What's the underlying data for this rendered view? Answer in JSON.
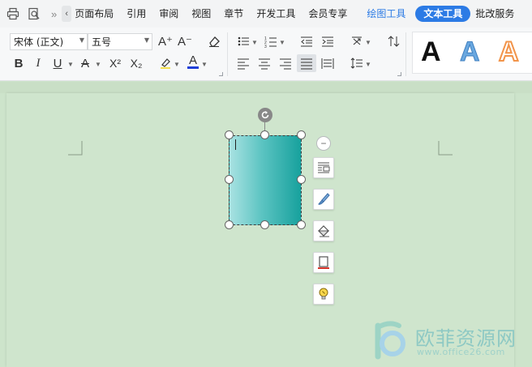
{
  "menubar": {
    "tabs": [
      {
        "label": "页面布局"
      },
      {
        "label": "引用"
      },
      {
        "label": "审阅"
      },
      {
        "label": "视图"
      },
      {
        "label": "章节"
      },
      {
        "label": "开发工具"
      },
      {
        "label": "会员专享"
      },
      {
        "label": "绘图工具"
      },
      {
        "label": "文本工具"
      },
      {
        "label": "批改服务"
      }
    ],
    "more_glyph": "»",
    "back_glyph": "‹"
  },
  "ribbon": {
    "font_name": "宋体 (正文)",
    "font_size": "五号",
    "grow_font": "A⁺",
    "shrink_font": "A⁻",
    "bold": "B",
    "italic": "I",
    "underline": "U",
    "char_color": "A",
    "superscript": "X²",
    "subscript": "X₂",
    "font_color": "A",
    "font_color_value": "#1e3ed8",
    "text_styles": [
      {
        "glyph": "A",
        "color": "#111111"
      },
      {
        "glyph": "A",
        "color": "#4a90d9"
      },
      {
        "glyph": "A",
        "color": "#f39a4a"
      }
    ]
  },
  "shape": {
    "gradient_colors": [
      "#a9e2e2",
      "#5cc4c2",
      "#17a19d"
    ]
  },
  "float_toolbar": {
    "collapse_glyph": "−",
    "buttons": [
      "text-wrap-icon",
      "shape-fill-icon",
      "shape-effect-icon",
      "shape-outline-icon",
      "lightbulb-icon"
    ]
  },
  "watermark": {
    "title": "欧菲资源网",
    "url": "www.office26.com"
  }
}
